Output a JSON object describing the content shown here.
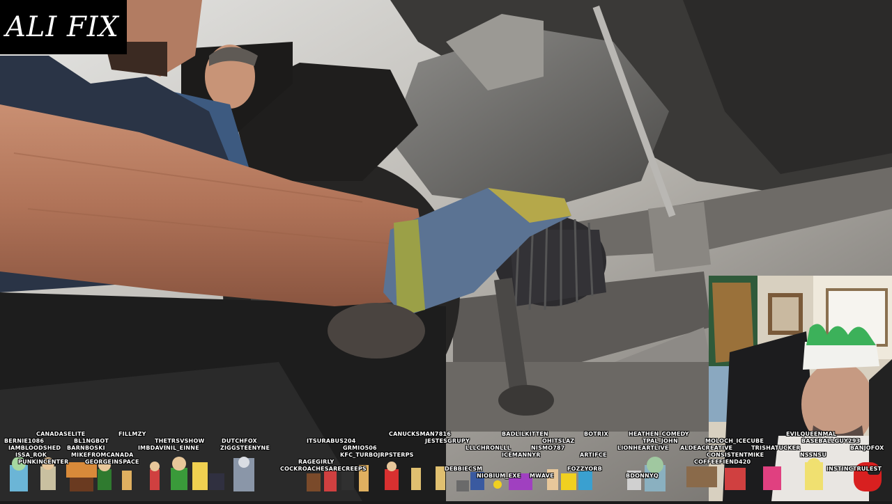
{
  "overlay": {
    "logo_text": "ALI FIX"
  },
  "chat_names": [
    "CANADASELITE",
    "FILLMZY",
    "BERNIE1086",
    "BL1NGBOT",
    "THETRSVSHOW",
    "DUTCHFOX",
    "ITSURABUS204",
    "CANUCKSMAN7816",
    "BADLILKITTEN",
    "BOTRIX",
    "HEATHEN_COMEDY",
    "EVILQUEENMAL",
    "IAMBLOODSHED",
    "BARNBOSKI",
    "IMBDAVE",
    "NIL_EINNE",
    "ZIGGSTEENYNE",
    "GRMIO506",
    "JESTESGRUPY",
    "OHITSLAZ",
    "TPAL_JOHN",
    "MOLOCH_ICECUBE",
    "BASEBALLGUY293",
    "ISSA_ROK",
    "MIKEFROMCANADA",
    "KFC_TURBOJRPSTERPS",
    "LLLCHRONLLL",
    "NISMO787",
    "LIONHEARTLIVE",
    "ALDEACREATIVE",
    "TRISHATUCKER",
    "BANJOFOX",
    "PUNKINCENTER",
    "GEORGEINSPACE",
    "RAGEGIRLY",
    "ICEMANNYR",
    "ARTIFCE",
    "CONSISTENTMIKE",
    "NSSNSU",
    "COCKROACHESARECREEPS",
    "DEBBIECSM",
    "FOZZYORB",
    "COFFEEFIEND420",
    "INSTINCTRULEST",
    "NIOBIUM_EXE",
    "MWAVE",
    "BDONNYQ"
  ]
}
